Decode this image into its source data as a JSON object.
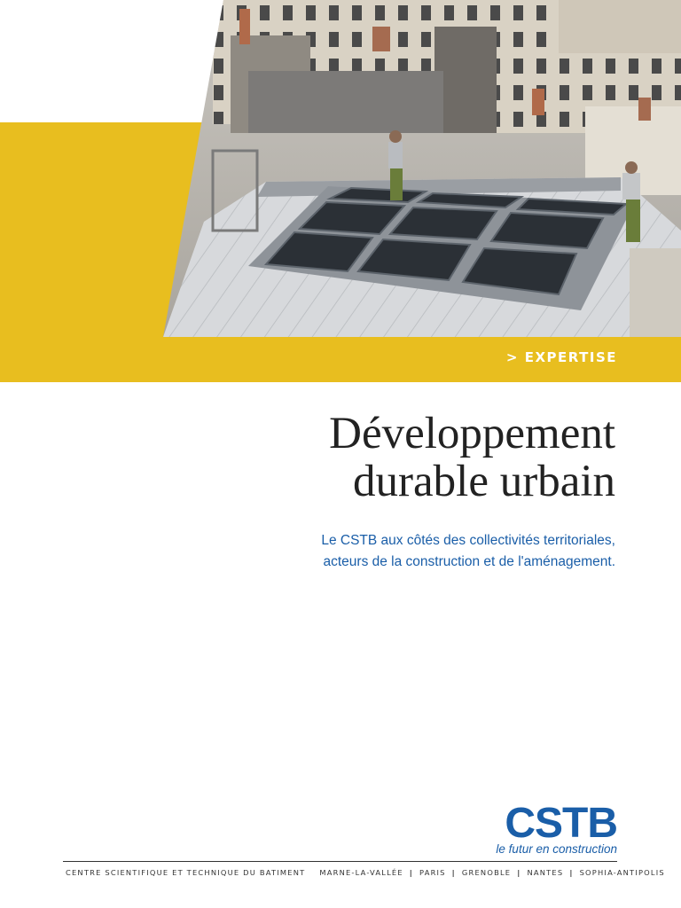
{
  "document": {
    "section_tag": "> EXPERTISE",
    "title_lines": [
      "Développement",
      "durable urbain"
    ],
    "subtitle_lines": [
      "Le CSTB aux côtés des collectivités territoriales,",
      "acteurs de la construction et de l'aménagement."
    ]
  },
  "logo": {
    "wordmark": "CSTB",
    "tagline": "le futur en construction"
  },
  "footer": {
    "organization": "CENTRE SCIENTIFIQUE ET TECHNIQUE DU BATIMENT",
    "locations": [
      "MARNE-LA-VALLÉE",
      "PARIS",
      "GRENOBLE",
      "NANTES",
      "SOPHIA-ANTIPOLIS"
    ]
  },
  "colors": {
    "accent_yellow": "#e8be1f",
    "brand_blue": "#1a5ea8"
  },
  "image": {
    "subject": "rooftop-solar-panels-photo"
  }
}
